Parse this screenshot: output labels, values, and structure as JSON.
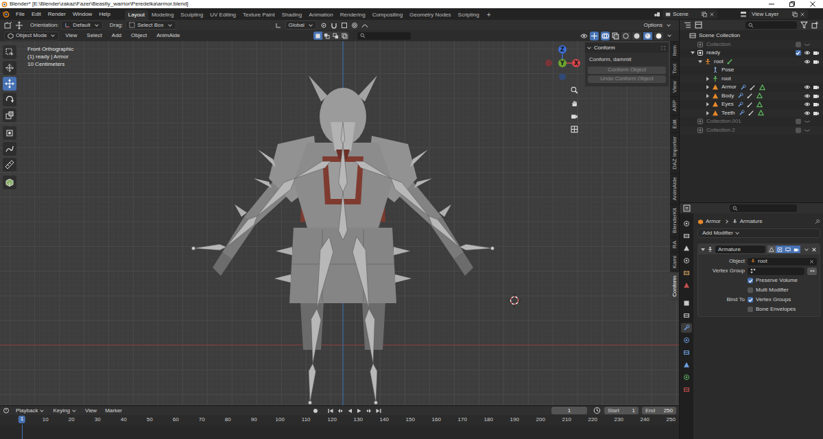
{
  "window": {
    "title": "Blender* [E:\\Blender\\zakaz\\Fazer\\Beastly_warrior\\Peredelka\\armor.blend]"
  },
  "menu": [
    "File",
    "Edit",
    "Render",
    "Window",
    "Help"
  ],
  "workspaces": [
    {
      "label": "Layout",
      "selected": true
    },
    {
      "label": "Modeling",
      "selected": false
    },
    {
      "label": "Sculpting",
      "selected": false
    },
    {
      "label": "UV Editing",
      "selected": false
    },
    {
      "label": "Texture Paint",
      "selected": false
    },
    {
      "label": "Shading",
      "selected": false
    },
    {
      "label": "Animation",
      "selected": false
    },
    {
      "label": "Rendering",
      "selected": false
    },
    {
      "label": "Compositing",
      "selected": false
    },
    {
      "label": "Geometry Nodes",
      "selected": false
    },
    {
      "label": "Scripting",
      "selected": false
    }
  ],
  "workspace_add": "+",
  "scene": "Scene",
  "view_layer": "View Layer",
  "viewport_header": {
    "orientation_label": "Orientation:",
    "orientation": "Default",
    "drag_label": "Drag:",
    "drag": "Select Box",
    "transform": "Global",
    "options": "Options",
    "mode": "Object Mode",
    "menus": [
      "View",
      "Select",
      "Add",
      "Object",
      "AnimAide"
    ],
    "shading": [
      {
        "selected": false
      },
      {
        "selected": false
      },
      {
        "selected": true
      },
      {
        "selected": false
      }
    ]
  },
  "toolbar": [
    {
      "selected": false
    },
    {
      "selected": false
    },
    {
      "selected": true
    },
    {
      "selected": false
    },
    {
      "selected": false
    },
    {
      "selected": false
    },
    {
      "selected": false
    },
    {
      "selected": false
    },
    {
      "selected": false
    }
  ],
  "overlay": [
    "Front Orthographic",
    "(1) ready | Armor",
    "10 Centimeters"
  ],
  "gizmo": {
    "x": "X",
    "y": "Y",
    "z": "Z"
  },
  "conform_panel": {
    "title": "Conform",
    "text": "Conform, dammit",
    "buttons": [
      {
        "label": "Conform Object",
        "disabled": true
      },
      {
        "label": "Undo Conform Object",
        "disabled": true
      }
    ]
  },
  "sidebar_tabs": [
    {
      "label": "Item",
      "selected": false
    },
    {
      "label": "Tool",
      "selected": false
    },
    {
      "label": "View",
      "selected": false
    },
    {
      "label": "ARP",
      "selected": false
    },
    {
      "label": "Edit",
      "selected": false
    },
    {
      "label": "DAZ Importer",
      "selected": false
    },
    {
      "label": "AnimAide",
      "selected": false
    },
    {
      "label": "BlenderKit",
      "selected": false
    },
    {
      "label": "RA",
      "selected": false
    },
    {
      "label": "Kami",
      "selected": false
    },
    {
      "label": "Conform",
      "selected": true
    }
  ],
  "outliner": {
    "rows": [
      {
        "label": "Scene Collection",
        "depth": 0,
        "kind": "scene",
        "greyed": false
      },
      {
        "label": "Collection",
        "depth": 1,
        "kind": "collection",
        "greyed": true,
        "checked": false,
        "visible": false
      },
      {
        "label": "ready",
        "depth": 1,
        "kind": "collection",
        "greyed": false,
        "expanded": true,
        "checked": true,
        "visible": true,
        "renderable": true
      },
      {
        "label": "root",
        "depth": 2,
        "kind": "armature",
        "greyed": false,
        "expanded": true,
        "visible": true,
        "renderable": true
      },
      {
        "label": "Pose",
        "depth": 3,
        "kind": "pose",
        "greyed": false
      },
      {
        "label": "root",
        "depth": 3,
        "kind": "armature-data",
        "greyed": false,
        "expanded": false
      },
      {
        "label": "Armor",
        "depth": 3,
        "kind": "mesh",
        "greyed": false,
        "expanded": false,
        "visible": true,
        "renderable": true
      },
      {
        "label": "Body",
        "depth": 3,
        "kind": "mesh",
        "greyed": false,
        "expanded": false,
        "visible": true,
        "renderable": true
      },
      {
        "label": "Eyes",
        "depth": 3,
        "kind": "mesh",
        "greyed": false,
        "expanded": false,
        "visible": true,
        "renderable": true
      },
      {
        "label": "Teeth",
        "depth": 3,
        "kind": "mesh",
        "greyed": false,
        "expanded": false,
        "visible": true,
        "renderable": true
      },
      {
        "label": "Collection.001",
        "depth": 1,
        "kind": "collection",
        "greyed": true,
        "checked": false,
        "visible": false
      },
      {
        "label": "Collection 2",
        "depth": 1,
        "kind": "collection",
        "greyed": true,
        "checked": false,
        "visible": false
      }
    ]
  },
  "property_tabs": [
    {
      "selected": false
    },
    {
      "selected": false
    },
    {
      "selected": false
    },
    {
      "selected": false
    },
    {
      "selected": false
    },
    {
      "selected": false
    },
    {
      "selected": false
    },
    {
      "selected": false
    },
    {
      "selected": true
    },
    {
      "selected": false
    },
    {
      "selected": false
    },
    {
      "selected": false
    },
    {
      "selected": false
    },
    {
      "selected": false
    }
  ],
  "properties": {
    "breadcrumb": [
      "Armor",
      "Armature"
    ],
    "add_modifier": "Add Modifier",
    "modifier": {
      "name": "Armature",
      "toggles": [
        {
          "on": false
        },
        {
          "on": true
        },
        {
          "on": true
        },
        {
          "on": true
        }
      ],
      "object_label": "Object",
      "object": "root",
      "vertex_group_label": "Vertex Group",
      "options": [
        {
          "label": "Preserve Volume",
          "checked": true
        },
        {
          "label": "Multi Modifier",
          "checked": false
        }
      ],
      "bind_label": "Bind To",
      "bind": [
        {
          "label": "Vertex Groups",
          "checked": true
        },
        {
          "label": "Bone Envelopes",
          "checked": false
        }
      ]
    }
  },
  "timeline": {
    "menus": [
      {
        "label": "Playback",
        "dropdown": true
      },
      {
        "label": "Keying",
        "dropdown": true
      },
      {
        "label": "View",
        "dropdown": false
      },
      {
        "label": "Marker",
        "dropdown": false
      }
    ],
    "frame": "1",
    "start_label": "Start",
    "start": "1",
    "end_label": "End",
    "end": "250",
    "current": "1",
    "ruler": [
      "10",
      "20",
      "30",
      "40",
      "50",
      "60",
      "70",
      "80",
      "90",
      "100",
      "110",
      "120",
      "130",
      "140",
      "150",
      "160",
      "170",
      "180",
      "190",
      "200",
      "210",
      "220",
      "230",
      "240",
      "250"
    ]
  }
}
